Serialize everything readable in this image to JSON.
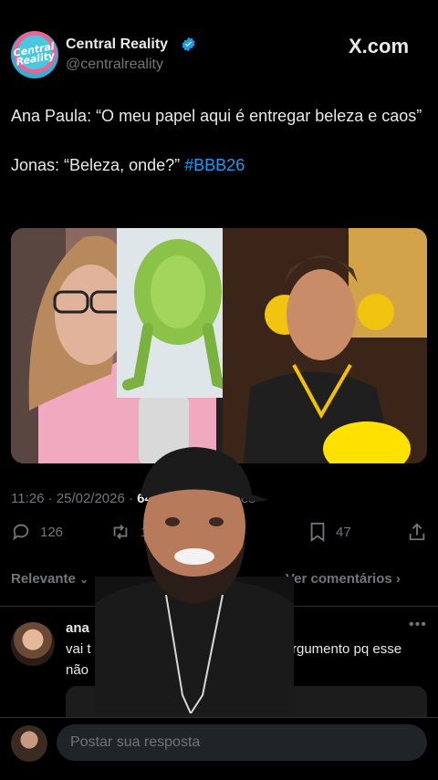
{
  "header": {
    "avatar_text": "Central Reality",
    "name": "Central Reality",
    "handle": "@centralreality",
    "site": "X.com"
  },
  "tweet": {
    "line1": "Ana Paula: “O meu papel aqui é entregar beleza e caos”",
    "line2_prefix": "Jonas: “Beleza, onde?” ",
    "hashtag": "#BBB26",
    "meta_time": "11:26 · 25/02/2026 · ",
    "meta_views": "64",
    "meta_tail": "es"
  },
  "actions": {
    "replies": "126",
    "retweets": "126",
    "bookmarks": "47"
  },
  "sort": {
    "label": "Relevante",
    "view_comments": "Ver comentários"
  },
  "reply": {
    "name": "ana",
    "text_start": "vai t",
    "text_end": "rgumento pq esse",
    "text_line2": "não"
  },
  "compose": {
    "placeholder": "Postar sua resposta"
  },
  "colors": {
    "background": "#000000",
    "link": "#1d9bf0",
    "muted": "#71767b",
    "text": "#e7e9ea"
  }
}
